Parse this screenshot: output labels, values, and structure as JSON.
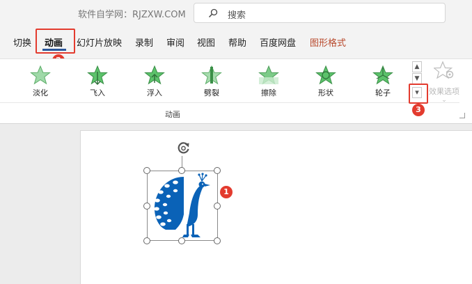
{
  "title_bar": {
    "document_title": "软件自学网：RJZXW.COM",
    "search_placeholder": "搜索",
    "search_icon": "search-icon"
  },
  "menu": {
    "tabs": [
      "切换",
      "动画",
      "幻灯片放映",
      "录制",
      "审阅",
      "视图",
      "帮助",
      "百度网盘",
      "图形格式"
    ],
    "active_tab": "动画"
  },
  "ribbon": {
    "group_label": "动画",
    "effects": [
      "淡化",
      "飞入",
      "浮入",
      "劈裂",
      "擦除",
      "形状",
      "轮子"
    ],
    "effect_options_label": "效果选项",
    "scroll_up": "▲",
    "scroll_down": "▼",
    "more_button": "▾"
  },
  "annotations": [
    "1",
    "2",
    "3"
  ],
  "slide": {
    "shape_icon": "peacock-icon",
    "rotate_icon": "rotate-handle-icon"
  },
  "colors": {
    "accent": "#2b579a",
    "highlight": "#e33b2e",
    "shape_fill": "#0a62b7",
    "star_fill": "#5cc26b"
  }
}
